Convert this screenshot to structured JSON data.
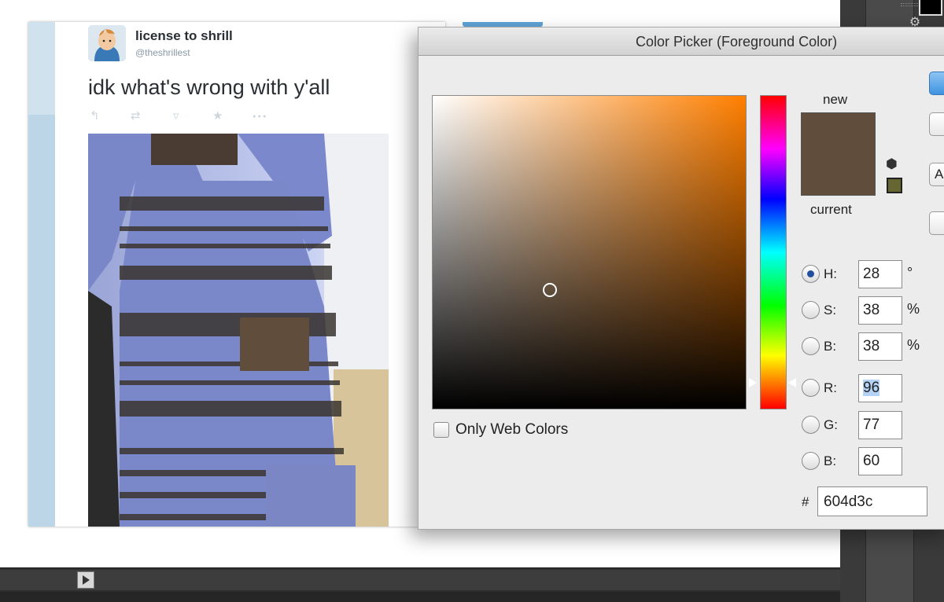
{
  "tweet": {
    "name": "license to shrill",
    "handle": "@theshrillest",
    "text": "idk what's wrong with y'all",
    "actions": [
      {
        "icon": "reply-icon",
        "glyph": "↰"
      },
      {
        "icon": "retweet-icon",
        "glyph": "⇄"
      },
      {
        "icon": "pocket-icon",
        "glyph": "▿"
      },
      {
        "icon": "favorite-icon",
        "glyph": "★"
      },
      {
        "icon": "more-icon",
        "glyph": "•••"
      }
    ],
    "overlay_colors": {
      "brown_patch": "#604d3c",
      "blue_patch": "#7a87c4"
    }
  },
  "picker": {
    "title": "Color Picker (Foreground Color)",
    "label_new": "new",
    "label_current": "current",
    "new_color": "#604d3c",
    "websafe_color": "#666633",
    "only_web_colors_label": "Only Web Colors",
    "only_web_colors_checked": false,
    "hsb": [
      {
        "key": "H:",
        "value": "28",
        "unit": "°",
        "selected": true
      },
      {
        "key": "S:",
        "value": "38",
        "unit": "%",
        "selected": false
      },
      {
        "key": "B:",
        "value": "38",
        "unit": "%",
        "selected": false
      }
    ],
    "rgb": [
      {
        "key": "R:",
        "value": "96",
        "selected": false,
        "highlighted": true
      },
      {
        "key": "G:",
        "value": "77",
        "selected": false
      },
      {
        "key": "B:",
        "value": "60",
        "selected": false
      }
    ],
    "hex_label": "#",
    "hex_value": "604d3c",
    "partial_button": "A"
  },
  "photoshop": {
    "foreground_swatch": "#000000"
  }
}
